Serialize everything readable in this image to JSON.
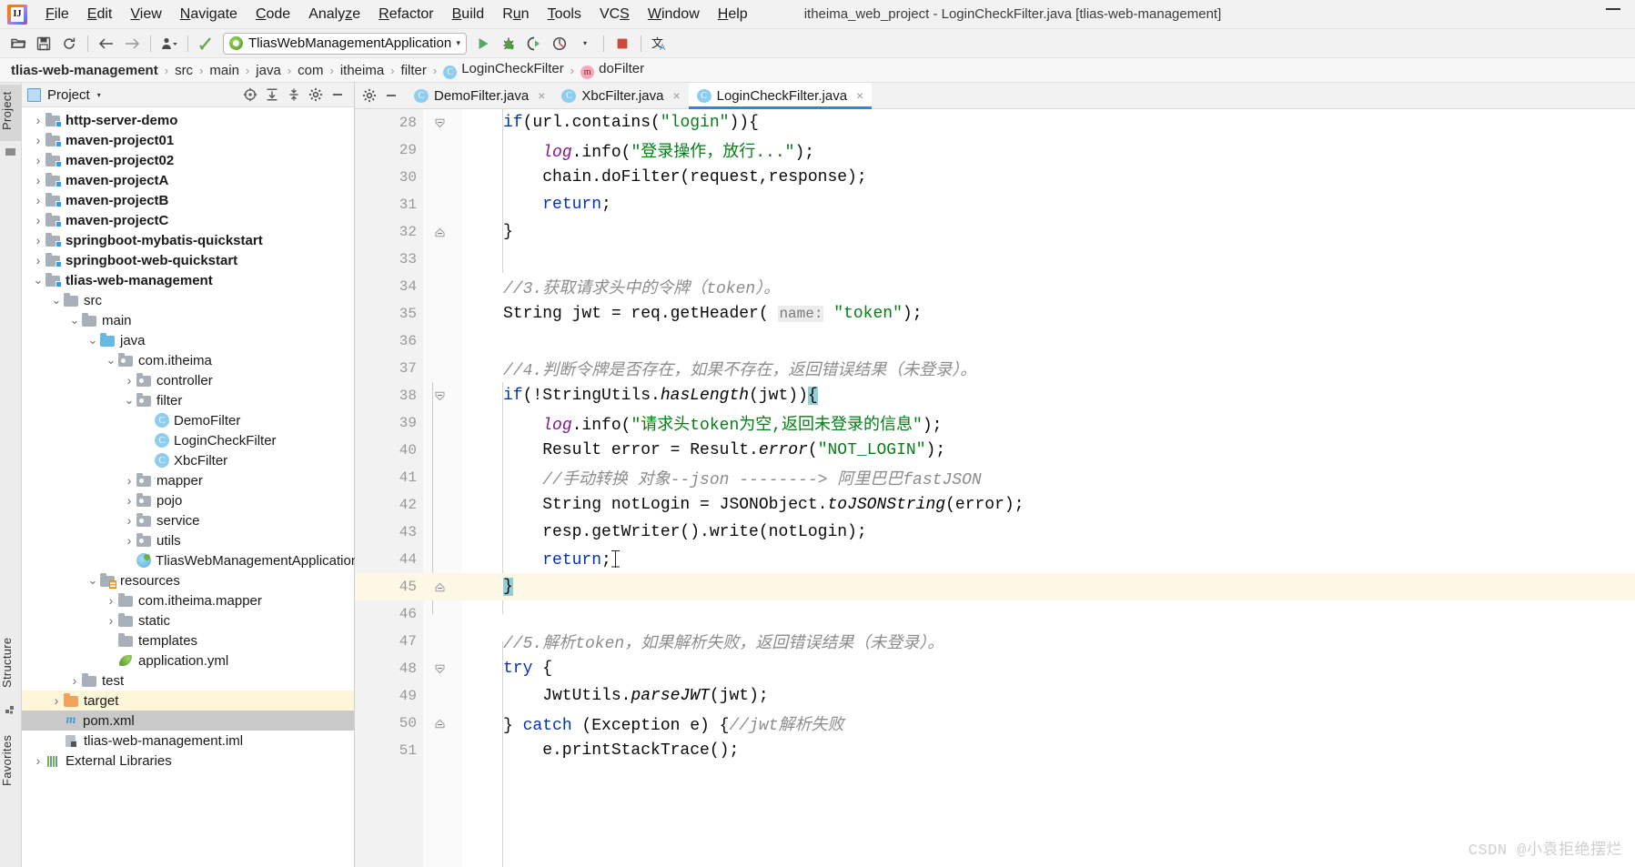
{
  "window": {
    "title": "itheima_web_project - LoginCheckFilter.java [tlias-web-management]",
    "logo_letter": "IJ",
    "minimize_label": "—"
  },
  "menu": {
    "items": [
      {
        "label": "File",
        "mnemonic": "F"
      },
      {
        "label": "Edit",
        "mnemonic": "E"
      },
      {
        "label": "View",
        "mnemonic": "V"
      },
      {
        "label": "Navigate",
        "mnemonic": "N"
      },
      {
        "label": "Code",
        "mnemonic": "C"
      },
      {
        "label": "Analyze",
        "mnemonic": "z"
      },
      {
        "label": "Refactor",
        "mnemonic": "R"
      },
      {
        "label": "Build",
        "mnemonic": "B"
      },
      {
        "label": "Run",
        "mnemonic": "u"
      },
      {
        "label": "Tools",
        "mnemonic": "T"
      },
      {
        "label": "VCS",
        "mnemonic": "S"
      },
      {
        "label": "Window",
        "mnemonic": "W"
      },
      {
        "label": "Help",
        "mnemonic": "H"
      }
    ]
  },
  "toolbar": {
    "buttons": [
      {
        "name": "open-folder-icon",
        "glyph": "open-folder"
      },
      {
        "name": "save-all-icon",
        "glyph": "save"
      },
      {
        "name": "sync-icon",
        "glyph": "refresh"
      },
      {
        "name": "back-icon",
        "glyph": "arrow-left"
      },
      {
        "name": "forward-icon",
        "glyph": "arrow-right"
      },
      {
        "name": "profile-icon",
        "glyph": "person-dropdown"
      },
      {
        "name": "build-icon",
        "glyph": "hammer"
      }
    ],
    "run_config": {
      "name": "TliasWebManagementApplication",
      "icon": "spring-boot-icon",
      "caret": "▾"
    },
    "run_button": "run-icon",
    "debug_button": "debug-icon",
    "coverage_button": "run-with-coverage-icon",
    "profile_button": "profiler-icon",
    "stop_button": "stop-icon",
    "translate_button": "translate-icon"
  },
  "breadcrumb": {
    "items": [
      {
        "label": "tlias-web-management",
        "bold": true,
        "badge": ""
      },
      {
        "label": "src",
        "bold": false,
        "badge": ""
      },
      {
        "label": "main",
        "bold": false,
        "badge": ""
      },
      {
        "label": "java",
        "bold": false,
        "badge": ""
      },
      {
        "label": "com",
        "bold": false,
        "badge": ""
      },
      {
        "label": "itheima",
        "bold": false,
        "badge": ""
      },
      {
        "label": "filter",
        "bold": false,
        "badge": ""
      },
      {
        "label": "LoginCheckFilter",
        "bold": false,
        "badge": "C"
      },
      {
        "label": "doFilter",
        "bold": false,
        "badge": "m"
      }
    ],
    "separator": "›"
  },
  "left_strip": {
    "tabs": [
      {
        "label": "Project",
        "selected": true
      },
      {
        "label": "Structure",
        "selected": false
      },
      {
        "label": "Favorites",
        "selected": false
      }
    ]
  },
  "project_panel": {
    "header": {
      "title": "Project",
      "caret": "▾",
      "icons": [
        {
          "name": "locate-icon",
          "glyph": "target"
        },
        {
          "name": "expand-all-icon",
          "glyph": "expand"
        },
        {
          "name": "collapse-all-icon",
          "glyph": "collapse"
        },
        {
          "name": "settings-gear-icon",
          "glyph": "gear"
        },
        {
          "name": "hide-panel-icon",
          "glyph": "minus"
        }
      ]
    },
    "tree": [
      {
        "label": "http-server-demo",
        "indent": 0,
        "chevron": "›",
        "icon": "module-folder",
        "bold": true,
        "state": "none"
      },
      {
        "label": "maven-project01",
        "indent": 0,
        "chevron": "›",
        "icon": "module-folder",
        "bold": true,
        "state": "none"
      },
      {
        "label": "maven-project02",
        "indent": 0,
        "chevron": "›",
        "icon": "module-folder",
        "bold": true,
        "state": "none"
      },
      {
        "label": "maven-projectA",
        "indent": 0,
        "chevron": "›",
        "icon": "module-folder",
        "bold": true,
        "state": "none"
      },
      {
        "label": "maven-projectB",
        "indent": 0,
        "chevron": "›",
        "icon": "module-folder",
        "bold": true,
        "state": "none"
      },
      {
        "label": "maven-projectC",
        "indent": 0,
        "chevron": "›",
        "icon": "module-folder",
        "bold": true,
        "state": "none"
      },
      {
        "label": "springboot-mybatis-quickstart",
        "indent": 0,
        "chevron": "›",
        "icon": "module-folder",
        "bold": true,
        "state": "none"
      },
      {
        "label": "springboot-web-quickstart",
        "indent": 0,
        "chevron": "›",
        "icon": "module-folder",
        "bold": true,
        "state": "none"
      },
      {
        "label": "tlias-web-management",
        "indent": 0,
        "chevron": "⌄",
        "icon": "module-folder",
        "bold": true,
        "state": "none"
      },
      {
        "label": "src",
        "indent": 1,
        "chevron": "⌄",
        "icon": "folder",
        "bold": false,
        "state": "none"
      },
      {
        "label": "main",
        "indent": 2,
        "chevron": "⌄",
        "icon": "folder",
        "bold": false,
        "state": "none"
      },
      {
        "label": "java",
        "indent": 3,
        "chevron": "⌄",
        "icon": "source-folder",
        "bold": false,
        "state": "none"
      },
      {
        "label": "com.itheima",
        "indent": 4,
        "chevron": "⌄",
        "icon": "package",
        "bold": false,
        "state": "none"
      },
      {
        "label": "controller",
        "indent": 5,
        "chevron": "›",
        "icon": "package",
        "bold": false,
        "state": "none"
      },
      {
        "label": "filter",
        "indent": 5,
        "chevron": "⌄",
        "icon": "package",
        "bold": false,
        "state": "none"
      },
      {
        "label": "DemoFilter",
        "indent": 6,
        "chevron": "",
        "icon": "class",
        "bold": false,
        "state": "none"
      },
      {
        "label": "LoginCheckFilter",
        "indent": 6,
        "chevron": "",
        "icon": "class",
        "bold": false,
        "state": "none"
      },
      {
        "label": "XbcFilter",
        "indent": 6,
        "chevron": "",
        "icon": "class",
        "bold": false,
        "state": "none"
      },
      {
        "label": "mapper",
        "indent": 5,
        "chevron": "›",
        "icon": "package",
        "bold": false,
        "state": "none"
      },
      {
        "label": "pojo",
        "indent": 5,
        "chevron": "›",
        "icon": "package",
        "bold": false,
        "state": "none"
      },
      {
        "label": "service",
        "indent": 5,
        "chevron": "›",
        "icon": "package",
        "bold": false,
        "state": "none"
      },
      {
        "label": "utils",
        "indent": 5,
        "chevron": "›",
        "icon": "package",
        "bold": false,
        "state": "none"
      },
      {
        "label": "TliasWebManagementApplication",
        "indent": 5,
        "chevron": "",
        "icon": "spring-class",
        "bold": false,
        "state": "none"
      },
      {
        "label": "resources",
        "indent": 3,
        "chevron": "⌄",
        "icon": "resources-folder",
        "bold": false,
        "state": "none"
      },
      {
        "label": "com.itheima.mapper",
        "indent": 4,
        "chevron": "›",
        "icon": "folder",
        "bold": false,
        "state": "none"
      },
      {
        "label": "static",
        "indent": 4,
        "chevron": "›",
        "icon": "folder",
        "bold": false,
        "state": "none"
      },
      {
        "label": "templates",
        "indent": 4,
        "chevron": "",
        "icon": "folder",
        "bold": false,
        "state": "none"
      },
      {
        "label": "application.yml",
        "indent": 4,
        "chevron": "",
        "icon": "yml",
        "bold": false,
        "state": "none"
      },
      {
        "label": "test",
        "indent": 2,
        "chevron": "›",
        "icon": "folder",
        "bold": false,
        "state": "none"
      },
      {
        "label": "target",
        "indent": 1,
        "chevron": "›",
        "icon": "target-folder",
        "bold": false,
        "state": "highlight"
      },
      {
        "label": "pom.xml",
        "indent": 1,
        "chevron": "",
        "icon": "maven",
        "bold": false,
        "state": "selected"
      },
      {
        "label": "tlias-web-management.iml",
        "indent": 1,
        "chevron": "",
        "icon": "iml",
        "bold": false,
        "state": "none"
      },
      {
        "label": "External Libraries",
        "indent": 0,
        "chevron": "›",
        "icon": "library",
        "bold": false,
        "state": "none"
      }
    ]
  },
  "editor": {
    "tabs": [
      {
        "label": "DemoFilter.java",
        "badge": "C",
        "active": false,
        "close": "×"
      },
      {
        "label": "XbcFilter.java",
        "badge": "C",
        "active": false,
        "close": "×"
      },
      {
        "label": "LoginCheckFilter.java",
        "badge": "C",
        "active": true,
        "close": "×"
      }
    ],
    "lines": [
      {
        "no": "28",
        "fold": "start",
        "current": false
      },
      {
        "no": "29",
        "fold": "",
        "current": false
      },
      {
        "no": "30",
        "fold": "",
        "current": false
      },
      {
        "no": "31",
        "fold": "",
        "current": false
      },
      {
        "no": "32",
        "fold": "end",
        "current": false
      },
      {
        "no": "33",
        "fold": "",
        "current": false
      },
      {
        "no": "34",
        "fold": "",
        "current": false
      },
      {
        "no": "35",
        "fold": "",
        "current": false
      },
      {
        "no": "36",
        "fold": "",
        "current": false
      },
      {
        "no": "37",
        "fold": "",
        "current": false
      },
      {
        "no": "38",
        "fold": "start",
        "current": false
      },
      {
        "no": "39",
        "fold": "",
        "current": false
      },
      {
        "no": "40",
        "fold": "",
        "current": false
      },
      {
        "no": "41",
        "fold": "",
        "current": false
      },
      {
        "no": "42",
        "fold": "",
        "current": false
      },
      {
        "no": "43",
        "fold": "",
        "current": false
      },
      {
        "no": "44",
        "fold": "",
        "current": false
      },
      {
        "no": "45",
        "fold": "end",
        "current": true
      },
      {
        "no": "46",
        "fold": "",
        "current": false
      },
      {
        "no": "47",
        "fold": "",
        "current": false
      },
      {
        "no": "48",
        "fold": "start",
        "current": false
      },
      {
        "no": "49",
        "fold": "",
        "current": false
      },
      {
        "no": "50",
        "fold": "end",
        "current": false
      },
      {
        "no": "51",
        "fold": "",
        "current": false
      }
    ],
    "code_text": {
      "l28": "if(url.contains(\"login\")){",
      "l29": "log.info(\"登录操作，放行...\");",
      "l30": "chain.doFilter(request,response);",
      "l31": "return;",
      "l32": "}",
      "l34": "//3.获取请求头中的令牌（token）。",
      "l35": "String jwt = req.getHeader( name: \"token\");",
      "l37": "//4.判断令牌是否存在，如果不存在，返回错误结果（未登录）。",
      "l38": "if(!StringUtils.hasLength(jwt)){",
      "l39": "log.info(\"请求头token为空,返回未登录的信息\");",
      "l40": "Result error = Result.error(\"NOT_LOGIN\");",
      "l41": "//手动转换 对象--json --------> 阿里巴巴fastJSON",
      "l42": "String notLogin = JSONObject.toJSONString(error);",
      "l43": "resp.getWriter().write(notLogin);",
      "l44": "return;",
      "l45": "}",
      "l47": "//5.解析token，如果解析失败，返回错误结果（未登录）。",
      "l48": "try {",
      "l49": "JwtUtils.parseJWT(jwt);",
      "l50": "} catch (Exception e) {//jwt解析失败",
      "l51": "e.printStackTrace();"
    },
    "param_hint": "name:"
  },
  "watermark": "CSDN @小袁拒绝摆烂",
  "colors": {
    "accent_tab": "#3b7fd6",
    "keyword": "#0033b3",
    "string": "#067d17",
    "comment": "#8c8c8c",
    "static_field": "#871094",
    "brace_match": "#93cfd7",
    "current_line": "#fdf8e6",
    "tree_selected": "#c9c9c9",
    "tree_highlight": "#fdf6d8"
  }
}
